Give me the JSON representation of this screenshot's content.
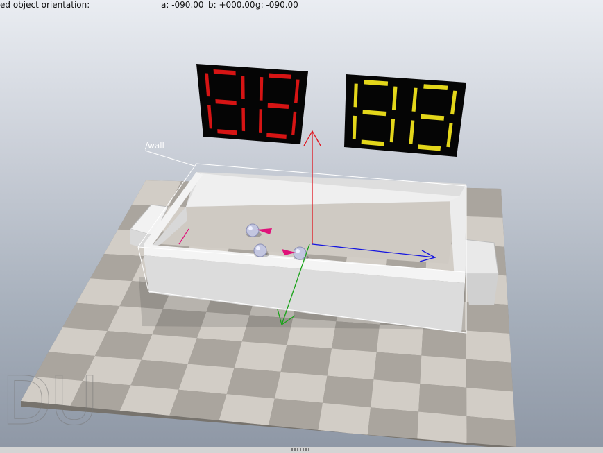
{
  "hud": {
    "label": "ed object orientation:",
    "a": "a: -090.00",
    "b": "b: +000.00",
    "g": "g: -090.00"
  },
  "scene": {
    "object_tag": "/wall",
    "watermark": "DU"
  },
  "scoreboards": {
    "left": {
      "color": "#d61414",
      "digits": [
        "8",
        "8"
      ]
    },
    "right": {
      "color": "#e3d61a",
      "digits": [
        "8",
        "8"
      ]
    }
  },
  "axes": {
    "x_color": "#1515e0",
    "y_color": "#17a317",
    "z_color": "#e0141e"
  },
  "colors": {
    "floor_light": "#d2cdc6",
    "floor_dark": "#aaa59e",
    "wall": "#e2e2e2",
    "arrow_marker": "#e0127a"
  }
}
